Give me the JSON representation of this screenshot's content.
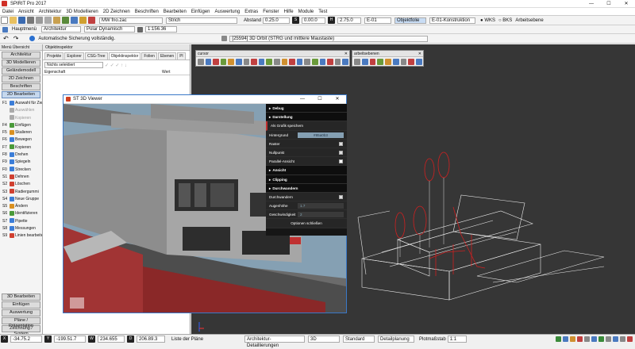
{
  "app_title": "SPIRIT Pro 2017",
  "menu": [
    "Datei",
    "Ansicht",
    "Architektur",
    "3D Modellieren",
    "2D Zeichnen",
    "Beschriften",
    "Bearbeiten",
    "Einfügen",
    "Auswertung",
    "Extras",
    "Fenster",
    "Hilfe",
    "Module",
    "Test"
  ],
  "toolbar1": {
    "file": "MW fno.zac",
    "linetype": "Strich",
    "abstand_label": "Abstand",
    "abstand": "0.25.0",
    "s_value": "0.00.0",
    "h_value": "2.75.0",
    "layer": "E-01",
    "objektfolie": "Objektfolie",
    "construction": "E-01-Konstruktion",
    "wks": "WKS",
    "bks": "BKS",
    "plane": "Arbeitsebene"
  },
  "toolbar2": {
    "hauptmenu": "Hauptmenü",
    "module": "Architektur",
    "snap": "Polar Dynamisch",
    "scale": "1:156.36"
  },
  "toolbar3": {
    "message": "Automatische Sicherung vollständig.",
    "hint": "[25594] 3D Orbit (STRG und mittlere Maustaste)"
  },
  "sidebar": {
    "header": "Menü Übersicht",
    "top_buttons": [
      "Architektur",
      "3D Modellieren",
      "Geländemodell",
      "2D Zeichnen",
      "Beschriften",
      "2D Bearbeiten"
    ],
    "functions": [
      {
        "key": "F1",
        "label": "Auswahl für Zw...",
        "color": "#3b7dd8"
      },
      {
        "key": "",
        "label": "Auswählen",
        "color": "#aaaaaa"
      },
      {
        "key": "",
        "label": "Kopieren",
        "color": "#aaaaaa"
      },
      {
        "key": "F4",
        "label": "Einfügen",
        "color": "#4a9a3a"
      },
      {
        "key": "F5",
        "label": "Skalieren",
        "color": "#d99020"
      },
      {
        "key": "F6",
        "label": "Bewegen",
        "color": "#3b7dd8"
      },
      {
        "key": "F7",
        "label": "Kopieren",
        "color": "#4a9a3a"
      },
      {
        "key": "F8",
        "label": "Drehen",
        "color": "#3b7dd8"
      },
      {
        "key": "F9",
        "label": "Spiegeln",
        "color": "#3b7dd8"
      },
      {
        "key": "F0",
        "label": "Strecken",
        "color": "#3b7dd8"
      },
      {
        "key": "S1",
        "label": "Dehnen",
        "color": "#d04030"
      },
      {
        "key": "S2",
        "label": "Löschen",
        "color": "#d04030"
      },
      {
        "key": "S3",
        "label": "Radiergummi",
        "color": "#d04030"
      },
      {
        "key": "S4",
        "label": "Neue Gruppe",
        "color": "#3b7dd8"
      },
      {
        "key": "S5",
        "label": "Ändern",
        "color": "#d99020"
      },
      {
        "key": "S6",
        "label": "Identifizieren",
        "color": "#4a9a3a"
      },
      {
        "key": "S7",
        "label": "Pipette",
        "color": "#3b7dd8"
      },
      {
        "key": "S8",
        "label": "Messungen",
        "color": "#3b7dd8"
      },
      {
        "key": "S9",
        "label": "Linien bearbeiten",
        "color": "#d04030"
      }
    ],
    "bottom_buttons": [
      "3D Bearbeiten",
      "Einfügen",
      "Auswertung",
      "Pläne / Präsentation",
      "Zeichnung / System"
    ]
  },
  "object_panel": {
    "title": "Objektinspektor",
    "tabs": [
      "Projekte",
      "Explorer",
      "CSG-Tree",
      "Objektinspektor",
      "Folien",
      "Ebenen",
      "Pl"
    ],
    "filter": "Nichts selektiert",
    "col_property": "Eigenschaft",
    "col_value": "Wert"
  },
  "cursor_toolbar": {
    "title": "cursor"
  },
  "arbeitsebenen_toolbar": {
    "title": "arbeitsebenen"
  },
  "viewer": {
    "title": "ST 3D Viewer",
    "settings": [
      {
        "label": "Debug",
        "type": "head"
      },
      {
        "label": "Darstellung",
        "type": "head"
      },
      {
        "label": "Als Grafik speichern",
        "type": "sub"
      },
      {
        "label": "Hintergrund",
        "type": "color",
        "value": "#85a0b3"
      },
      {
        "label": "Raster",
        "type": "check",
        "checked": true
      },
      {
        "label": "Nullpunkt",
        "type": "check",
        "checked": true
      },
      {
        "label": "Parallel-Ansicht",
        "type": "check",
        "checked": false
      },
      {
        "label": "Ansicht",
        "type": "head"
      },
      {
        "label": "Clipping",
        "type": "head"
      },
      {
        "label": "Durchwandern",
        "type": "head"
      },
      {
        "label": "Durchwandern",
        "type": "check",
        "checked": true
      },
      {
        "label": "Augenhöhe",
        "type": "value",
        "value": "1.7"
      },
      {
        "label": "Geschwindigkeit",
        "type": "value",
        "value": "2"
      },
      {
        "label": "Optionen schließen",
        "type": "footer"
      }
    ]
  },
  "statusbar": {
    "x_label": "X",
    "x_value": "-34.75.2",
    "y_label": "Y",
    "y_value": "-199.51.7",
    "w_label": "W",
    "w_value": "234.655",
    "d_label": "D",
    "d_value": "206.89.3",
    "layer_text": "Liste der Pläne",
    "mode": "Architektur-Detaillierungen",
    "view": "3D",
    "standard": "Standard",
    "detail": "Detailplanung",
    "plot_label": "Plotmaßstab",
    "plot_value": "1:1"
  }
}
